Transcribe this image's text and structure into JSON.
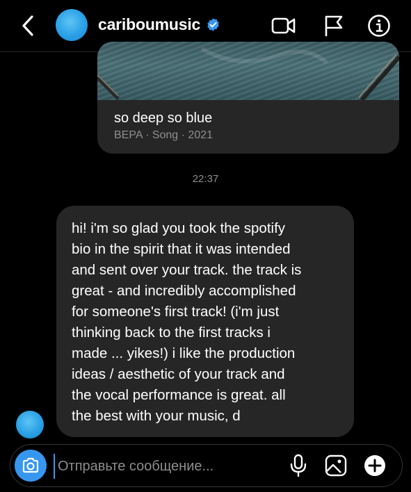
{
  "header": {
    "username": "cariboumusic",
    "icons": {
      "back": "chevron-left-icon",
      "verified": "verified-badge-icon",
      "video": "video-camera-icon",
      "flag": "flag-icon",
      "info": "info-icon"
    }
  },
  "shared_track": {
    "title": "so deep so blue",
    "subtitle": "BEPA · Song · 2021"
  },
  "timestamp": "22:37",
  "message": {
    "text": "hi! i'm so glad you took the spotify\nbio in the spirit that it was intended\nand sent over your track. the track is\ngreat - and incredibly accomplished\nfor someone's first track! (i'm just\nthinking back to the first tracks i\nmade ... yikes!) i like the production\nideas / aesthetic of your track and\nthe vocal performance is great. all\nthe best with your music, d"
  },
  "composer": {
    "placeholder": "Отправьте сообщение...",
    "value": "",
    "icons": {
      "camera": "camera-icon",
      "mic": "microphone-icon",
      "gallery": "image-gallery-icon",
      "add": "plus-circle-icon"
    }
  },
  "colors": {
    "background": "#000000",
    "bubble": "#262626",
    "accent": "#3797f0",
    "verified": "#3797f0",
    "muted_text": "#8e8e8e",
    "avatar": "#2aa0e6"
  }
}
